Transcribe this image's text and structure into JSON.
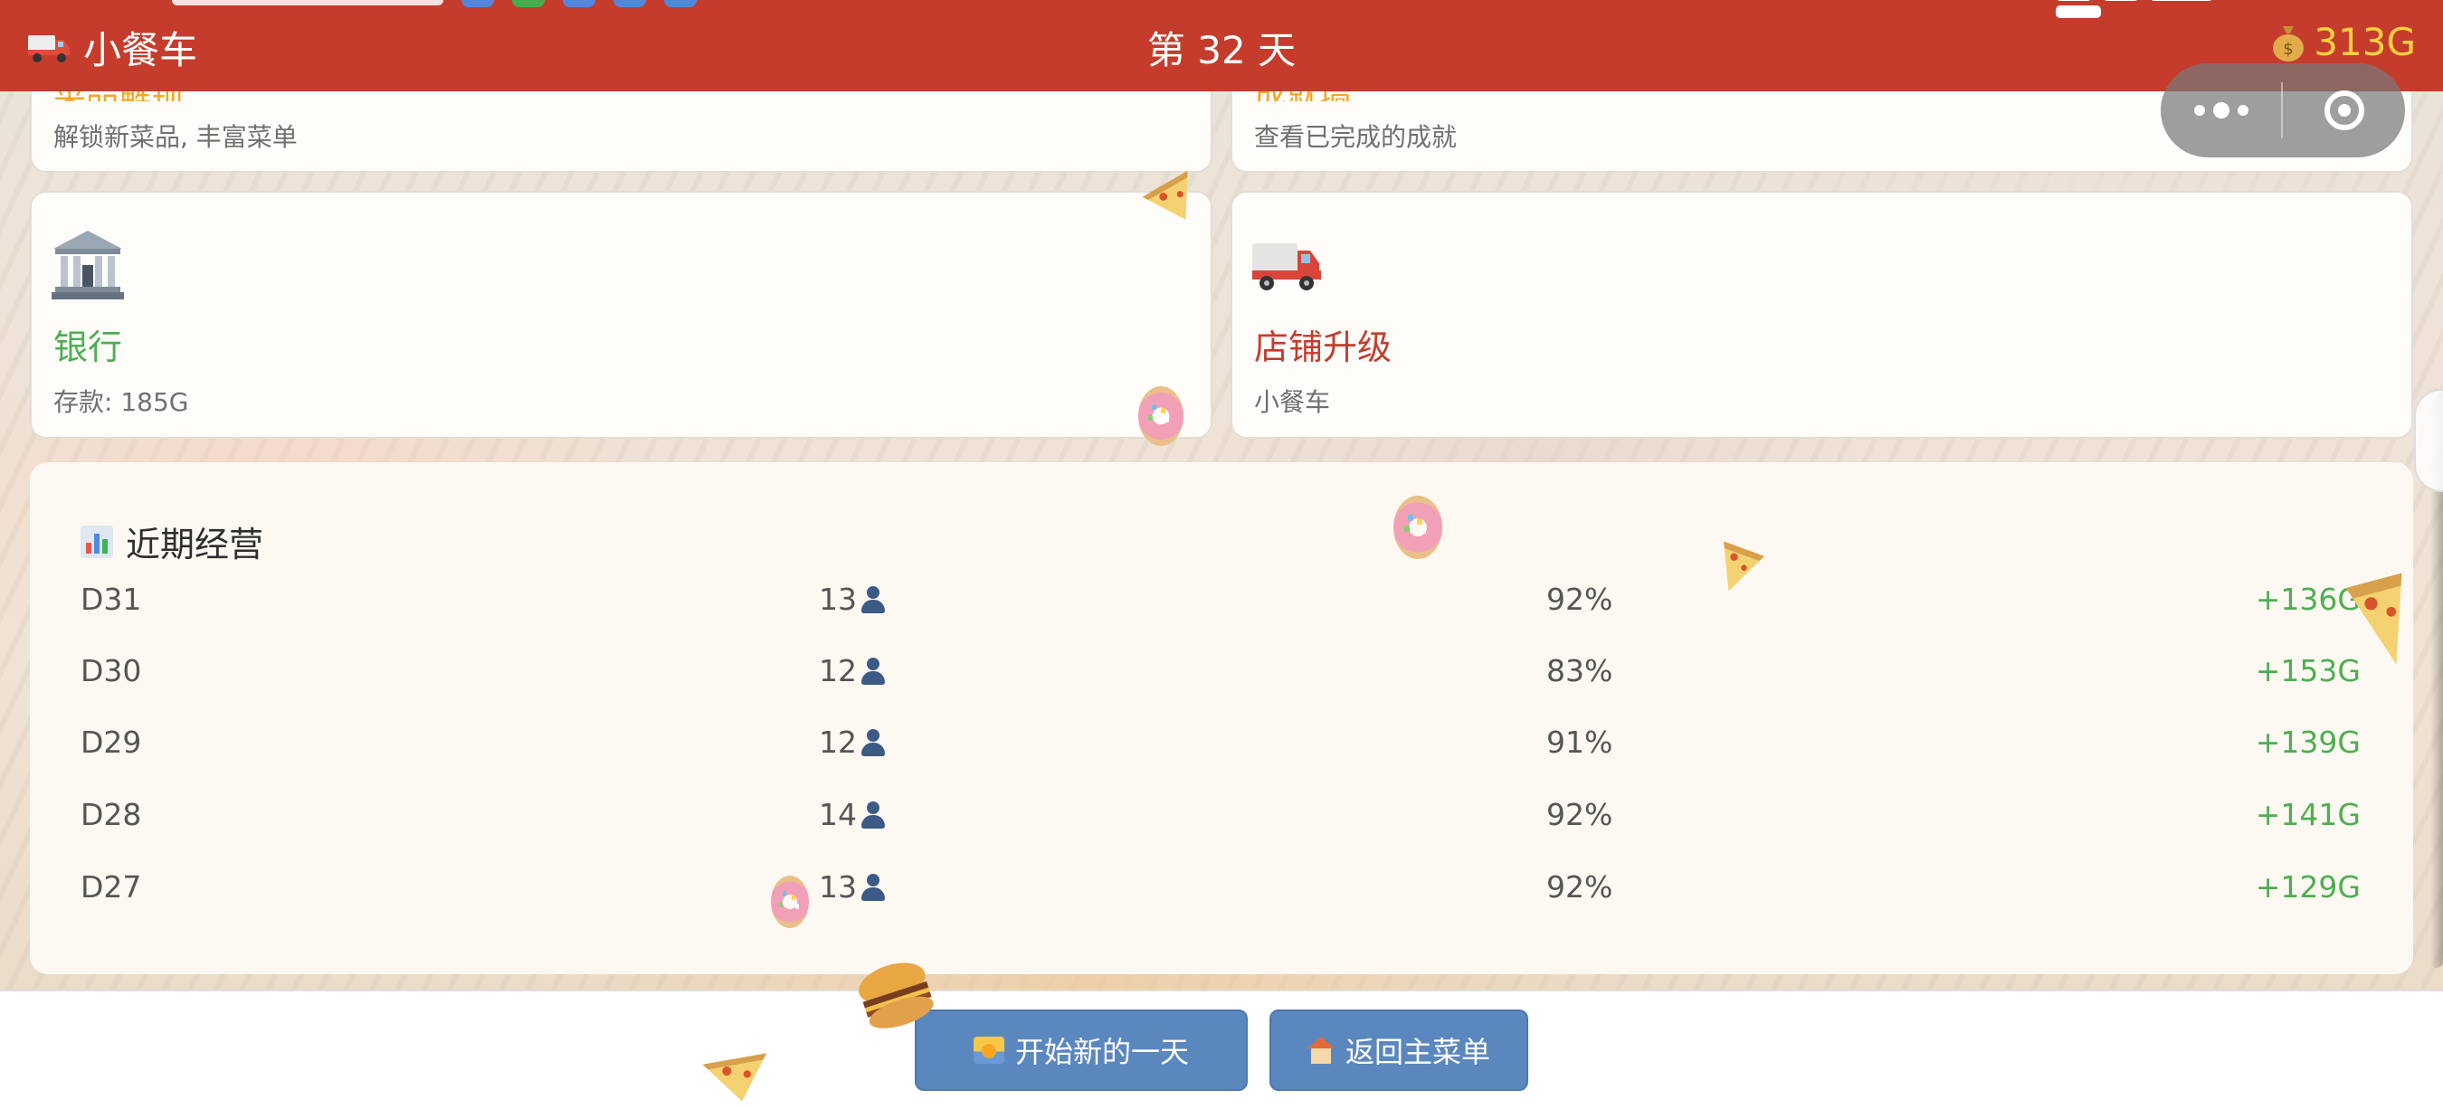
{
  "header": {
    "app_name": "小餐车",
    "day_label": "第 32 天",
    "gold": "313G",
    "bg_color": "#c53c2c",
    "gold_color": "#ffd23f"
  },
  "capsule": {
    "more_icon": "more-dots-icon",
    "close_icon": "target-circle-icon"
  },
  "cards": {
    "unlock": {
      "desc": "解锁新菜品, 丰富菜单"
    },
    "achievements": {
      "desc": "查看已完成的成就"
    },
    "bank": {
      "icon": "bank-building-icon",
      "title": "银行",
      "desc": "存款: 185G",
      "title_color": "#4caf50"
    },
    "upgrade": {
      "icon": "food-truck-icon",
      "title": "店铺升级",
      "desc": "小餐车",
      "title_color": "#c53c2c"
    }
  },
  "stats": {
    "icon": "bar-chart-icon",
    "title": "近期经营",
    "rows": [
      {
        "day": "D31",
        "customers": "13",
        "rate": "92%",
        "income": "+136G"
      },
      {
        "day": "D30",
        "customers": "12",
        "rate": "83%",
        "income": "+153G"
      },
      {
        "day": "D29",
        "customers": "12",
        "rate": "91%",
        "income": "+139G"
      },
      {
        "day": "D28",
        "customers": "14",
        "rate": "92%",
        "income": "+141G"
      },
      {
        "day": "D27",
        "customers": "13",
        "rate": "92%",
        "income": "+129G"
      }
    ],
    "income_color": "#4caf50"
  },
  "actions": {
    "start_day": "开始新的一天",
    "back_home": "返回主菜单",
    "button_color": "#5b87bf"
  }
}
